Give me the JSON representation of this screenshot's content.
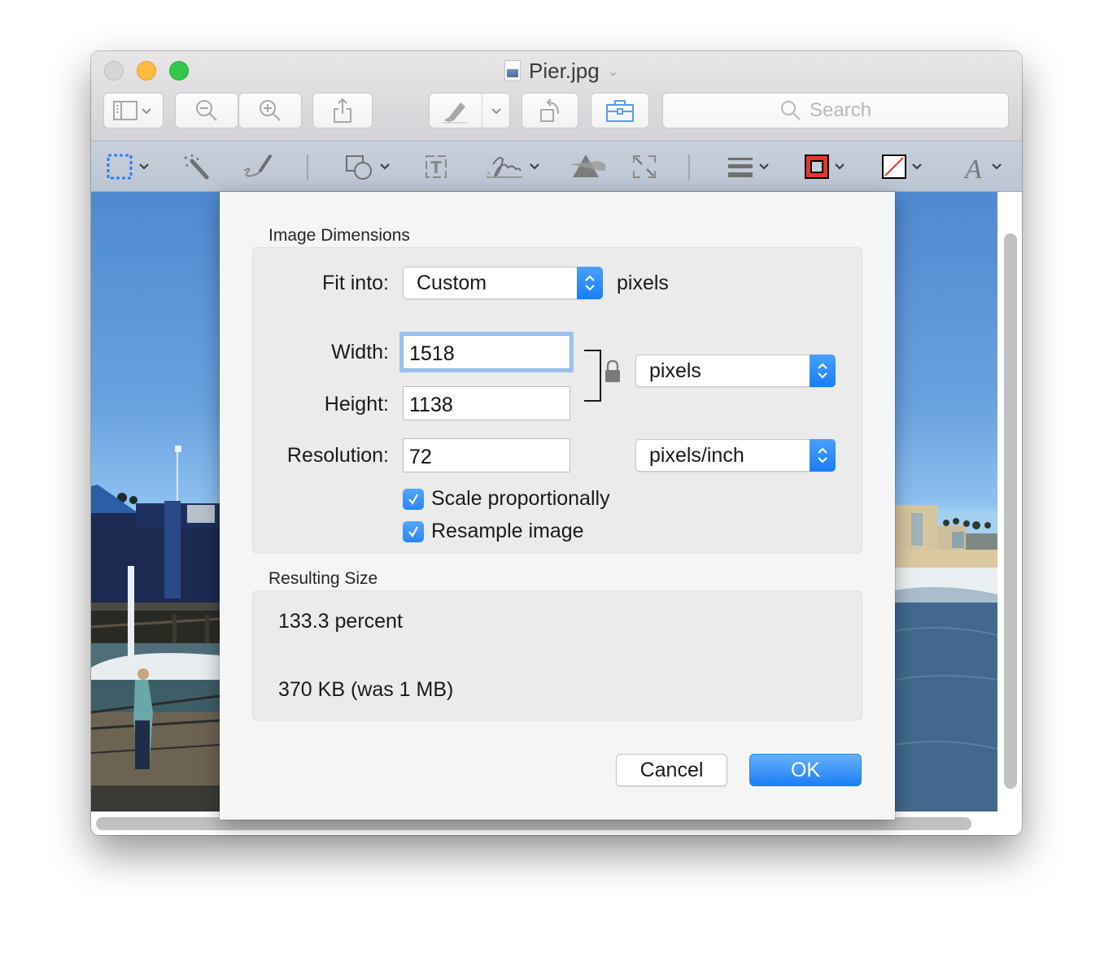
{
  "window": {
    "title": "Pier.jpg",
    "traffic_lights": [
      "close",
      "minimize",
      "zoom"
    ]
  },
  "toolbar": {
    "buttons": [
      {
        "name": "sidebar-view",
        "icon": "sidebar-icon",
        "has_menu": true
      },
      {
        "name": "zoom-out",
        "icon": "zoom-out-icon"
      },
      {
        "name": "zoom-in",
        "icon": "zoom-in-icon"
      },
      {
        "name": "share",
        "icon": "share-icon"
      },
      {
        "name": "highlight",
        "icon": "highlighter-icon",
        "has_menu": true
      },
      {
        "name": "rotate",
        "icon": "rotate-left-icon"
      },
      {
        "name": "markup-toolbox",
        "icon": "toolbox-icon",
        "active": true
      }
    ],
    "search_placeholder": "Search"
  },
  "markup_bar": {
    "tools": [
      {
        "name": "rectangular-selection",
        "icon": "marquee-selection-icon",
        "has_menu": true,
        "active": true
      },
      {
        "name": "instant-alpha",
        "icon": "magic-wand-icon"
      },
      {
        "name": "sketch",
        "icon": "sketch-pen-icon"
      },
      {
        "name": "shapes",
        "icon": "shapes-icon",
        "has_menu": true
      },
      {
        "name": "text",
        "icon": "text-box-icon"
      },
      {
        "name": "sign",
        "icon": "signature-icon",
        "has_menu": true
      },
      {
        "name": "adjust-color",
        "icon": "prism-icon"
      },
      {
        "name": "adjust-size",
        "icon": "resize-icon"
      },
      {
        "name": "shape-style",
        "icon": "line-style-icon",
        "has_menu": true
      },
      {
        "name": "border-color",
        "icon": "border-color-icon",
        "has_menu": true,
        "color": "#e8352f"
      },
      {
        "name": "fill-color",
        "icon": "fill-color-none-icon",
        "has_menu": true
      },
      {
        "name": "text-style",
        "icon": "font-style-icon",
        "has_menu": true
      }
    ]
  },
  "dialog": {
    "image_dimensions_label": "Image Dimensions",
    "fit_into": {
      "label": "Fit into:",
      "value": "Custom",
      "unit": "pixels"
    },
    "width": {
      "label": "Width:",
      "value": "1518"
    },
    "height": {
      "label": "Height:",
      "value": "1138"
    },
    "size_unit": "pixels",
    "resolution": {
      "label": "Resolution:",
      "value": "72",
      "unit": "pixels/inch"
    },
    "scale_proportionally": {
      "label": "Scale proportionally",
      "checked": true
    },
    "resample_image": {
      "label": "Resample image",
      "checked": true
    },
    "resulting_size_label": "Resulting Size",
    "result_percent": "133.3 percent",
    "result_filesize": "370 KB (was 1 MB)",
    "cancel_label": "Cancel",
    "ok_label": "OK"
  },
  "colors": {
    "accent": "#1b7ff5",
    "border_color_swatch": "#e8352f"
  }
}
